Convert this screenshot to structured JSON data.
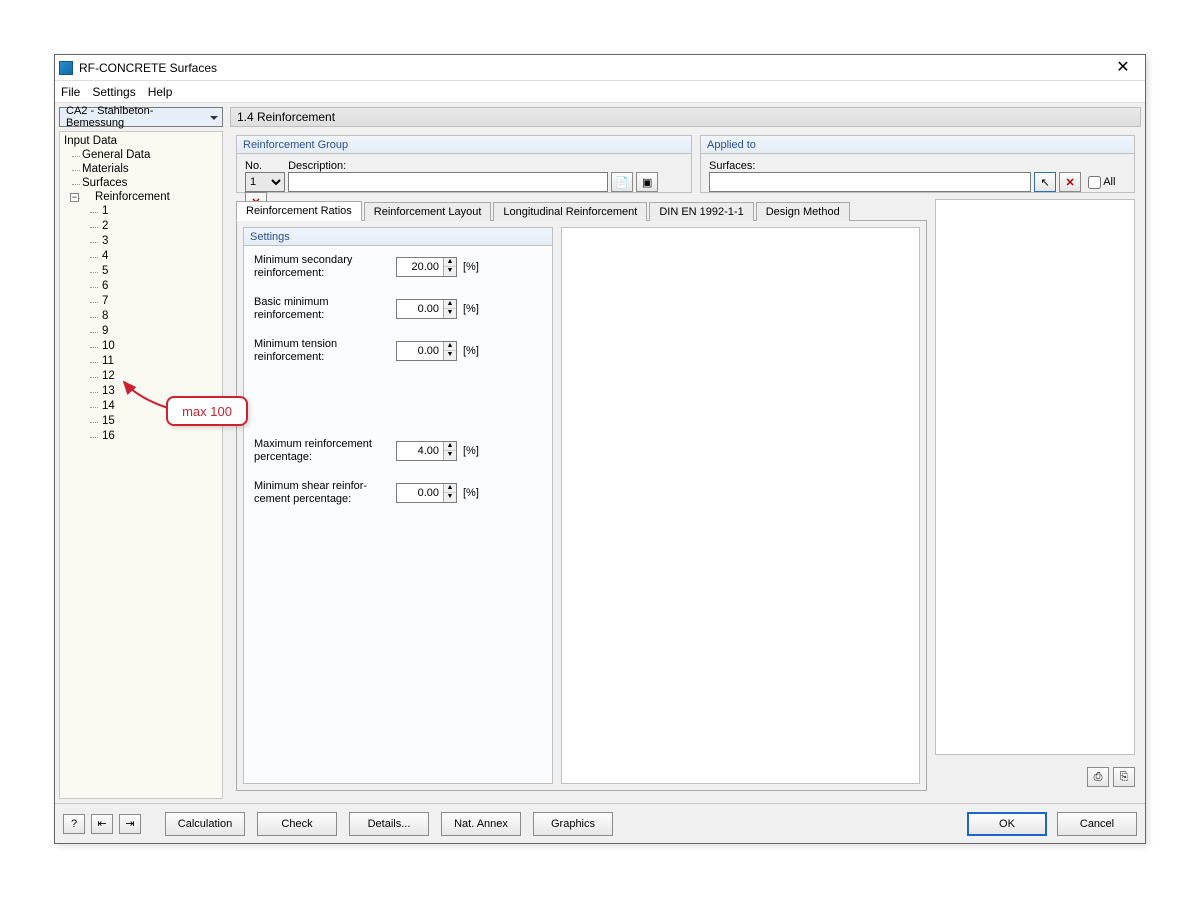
{
  "window": {
    "title": "RF-CONCRETE Surfaces"
  },
  "menubar": [
    "File",
    "Settings",
    "Help"
  ],
  "case_selector": "CA2 - Stahlbeton-Bemessung",
  "content_header": "1.4 Reinforcement",
  "tree": {
    "root": "Input Data",
    "items": [
      "General Data",
      "Materials",
      "Surfaces"
    ],
    "reinforcement_label": "Reinforcement",
    "reinf_children": [
      "1",
      "2",
      "3",
      "4",
      "5",
      "6",
      "7",
      "8",
      "9",
      "10",
      "11",
      "12",
      "13",
      "14",
      "15",
      "16"
    ]
  },
  "rg": {
    "title": "Reinforcement Group",
    "no_label": "No.",
    "desc_label": "Description:",
    "no_value": "1",
    "desc_value": ""
  },
  "applied": {
    "title": "Applied to",
    "surfaces_label": "Surfaces:",
    "surfaces_value": "",
    "all_label": "All"
  },
  "tabs": [
    "Reinforcement Ratios",
    "Reinforcement Layout",
    "Longitudinal Reinforcement",
    "DIN EN 1992-1-1",
    "Design Method"
  ],
  "settings": {
    "title": "Settings",
    "rows": [
      {
        "label": "Minimum secondary reinforcement:",
        "value": "20.00",
        "unit": "[%]"
      },
      {
        "label": "Basic minimum reinforcement:",
        "value": "0.00",
        "unit": "[%]"
      },
      {
        "label": "Minimum tension reinforcement:",
        "value": "0.00",
        "unit": "[%]"
      }
    ],
    "rows2": [
      {
        "label": "Maximum reinforcement percentage:",
        "value": "4.00",
        "unit": "[%]"
      },
      {
        "label": "Minimum shear reinfor-\ncement percentage:",
        "value": "0.00",
        "unit": "[%]"
      }
    ]
  },
  "footer": {
    "buttons": [
      "Calculation",
      "Check",
      "Details...",
      "Nat. Annex",
      "Graphics"
    ],
    "ok": "OK",
    "cancel": "Cancel"
  },
  "callout": "max 100"
}
